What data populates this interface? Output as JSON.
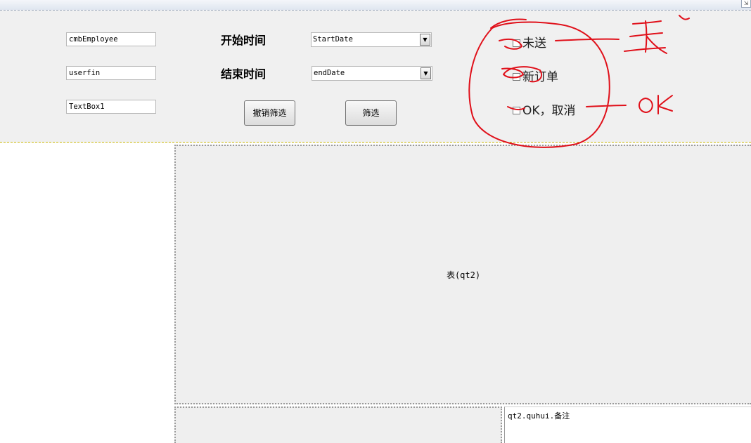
{
  "filters": {
    "employee_box": "cmbEmployee",
    "userfin_box": "userfin",
    "textbox1": "TextBox1",
    "start_label": "开始时间",
    "end_label": "结束时间",
    "start_date": "StartDate",
    "end_date": "endDate",
    "cancel_filter_button": "撤销筛选",
    "filter_button": "筛选"
  },
  "status_checkboxes": [
    {
      "label": "未送",
      "checked": false
    },
    {
      "label": "新订单",
      "checked": false
    },
    {
      "label": "OK，取消",
      "checked": false
    }
  ],
  "table": {
    "caption": "表(qt2)"
  },
  "note_field": {
    "binding": "qt2.quhui.备注"
  },
  "annotations": {
    "note_biao": "表",
    "note_ok": "OK",
    "ink_color": "#e0101a"
  }
}
